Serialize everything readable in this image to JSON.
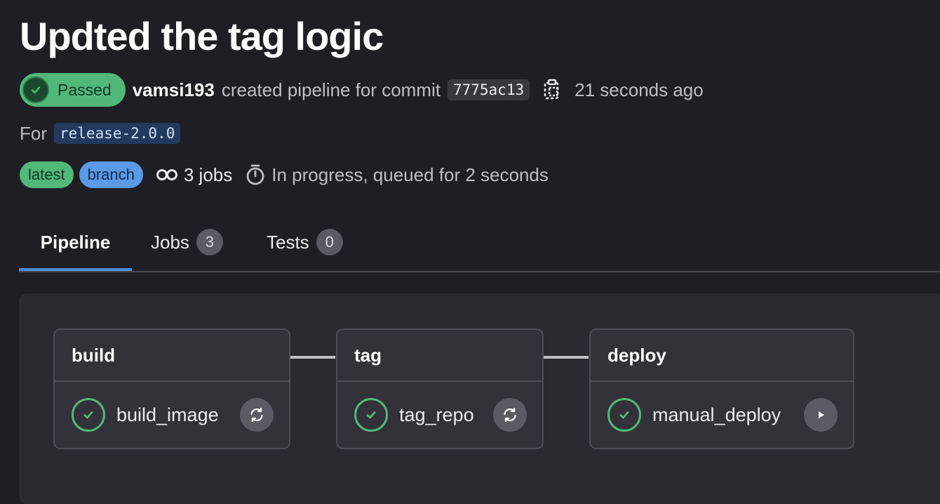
{
  "header": {
    "title": "Updted the tag logic",
    "status": "Passed",
    "author": "vamsi193",
    "action_text": "created pipeline for commit",
    "commit_sha": "7775ac13",
    "time_ago": "21 seconds ago",
    "for_label": "For",
    "ref": "release-2.0.0",
    "badges": [
      "latest",
      "branch"
    ],
    "jobs_count": "3 jobs",
    "progress_text": "In progress, queued for 2 seconds"
  },
  "tabs": [
    {
      "label": "Pipeline",
      "count": null,
      "active": true
    },
    {
      "label": "Jobs",
      "count": "3",
      "active": false
    },
    {
      "label": "Tests",
      "count": "0",
      "active": false
    }
  ],
  "stages": [
    {
      "name": "build",
      "job": {
        "name": "build_image",
        "status": "success",
        "action": "retry-icon"
      }
    },
    {
      "name": "tag",
      "job": {
        "name": "tag_repo",
        "status": "success",
        "action": "retry-icon"
      }
    },
    {
      "name": "deploy",
      "job": {
        "name": "manual_deploy",
        "status": "success",
        "action": "play-icon"
      }
    }
  ],
  "colors": {
    "success": "#52b87a",
    "info": "#5a9ae6",
    "active_tab": "#4e8ed6",
    "background": "#1f1e24"
  }
}
